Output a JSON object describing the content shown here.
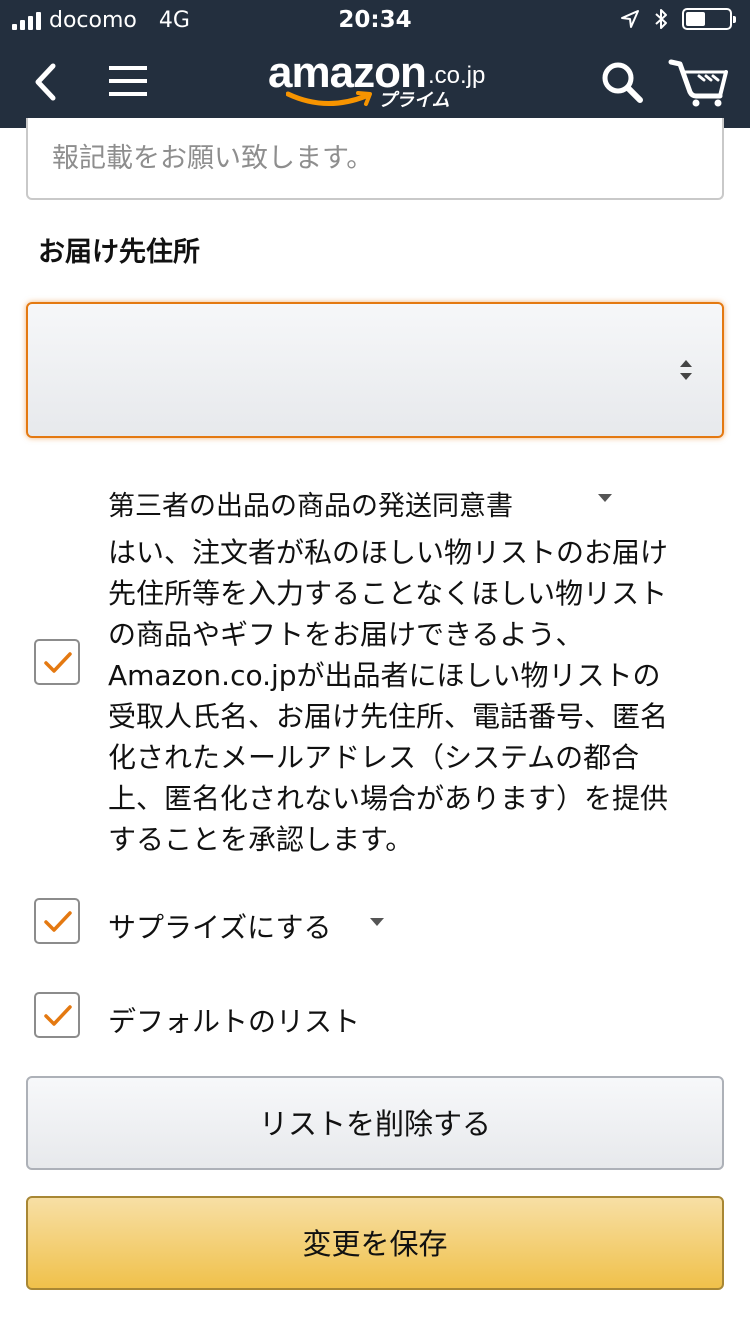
{
  "status_bar": {
    "signal_bars": 4,
    "carrier": "docomo",
    "network": "4G",
    "time": "20:34",
    "location_icon": "location-arrow-icon",
    "bluetooth_icon": "bluetooth-icon",
    "battery_level": 0.45
  },
  "nav": {
    "back_icon": "chevron-left-icon",
    "menu_icon": "hamburger-menu-icon",
    "logo_word": "amazon",
    "logo_tld": ".co.jp",
    "logo_sub": "プライム",
    "search_icon": "search-icon",
    "cart_icon": "cart-icon"
  },
  "form": {
    "textarea_tail": "報記載をお願い致します。",
    "address_label": "お届け先住所",
    "address_select_value": "",
    "consent": {
      "checked": true,
      "title": "第三者の出品の商品の発送同意書",
      "lines": [
        "はい、注文者が私のほしい物リストのお届け",
        "先住所等を入力することなくほしい物リスト",
        "の商品やギフトをお届けできるよう、",
        "Amazon.co.jpが出品者にほしい物リストの",
        "受取人氏名、お届け先住所、電話番号、匿名",
        "化されたメールアドレス（システムの都合",
        "上、匿名化されない場合があります）を提供",
        "することを承認します。"
      ]
    },
    "surprise": {
      "checked": true,
      "label": "サプライズにする"
    },
    "default_list": {
      "checked": true,
      "label": "デフォルトのリスト"
    },
    "delete_button": "リストを削除する",
    "save_button": "変更を保存"
  },
  "colors": {
    "header_bg": "#232f3e",
    "accent_orange": "#e47911",
    "save_button_bg": "#f0c14b"
  }
}
